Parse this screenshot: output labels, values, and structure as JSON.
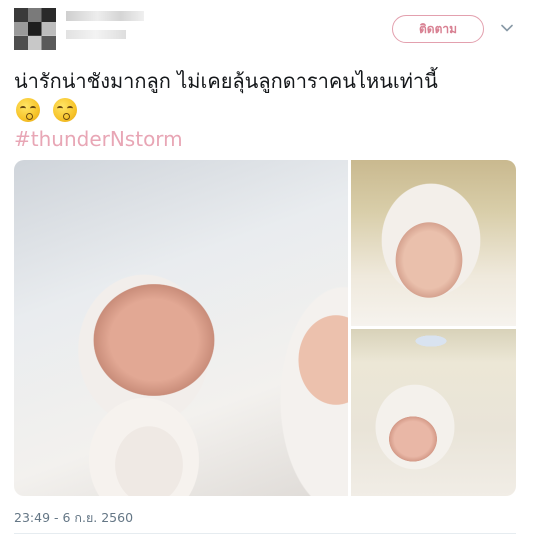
{
  "header": {
    "follow_label": "ติดตาม"
  },
  "tweet": {
    "text": "น่ารักน่าชังมากลูก ไม่เคยลุ้นลูกดาราคนไหนเท่านี้",
    "hashtag": "#thunderNstorm",
    "emoji_count": 2,
    "timestamp": "23:49 - 6 ก.ย. 2560"
  },
  "colors": {
    "follow_accent": "#d88092",
    "hashtag": "#e8a6b5",
    "timestamp": "#657786"
  },
  "icons": [
    "avatar",
    "chevron-down-icon",
    "kissing-face-icon"
  ]
}
